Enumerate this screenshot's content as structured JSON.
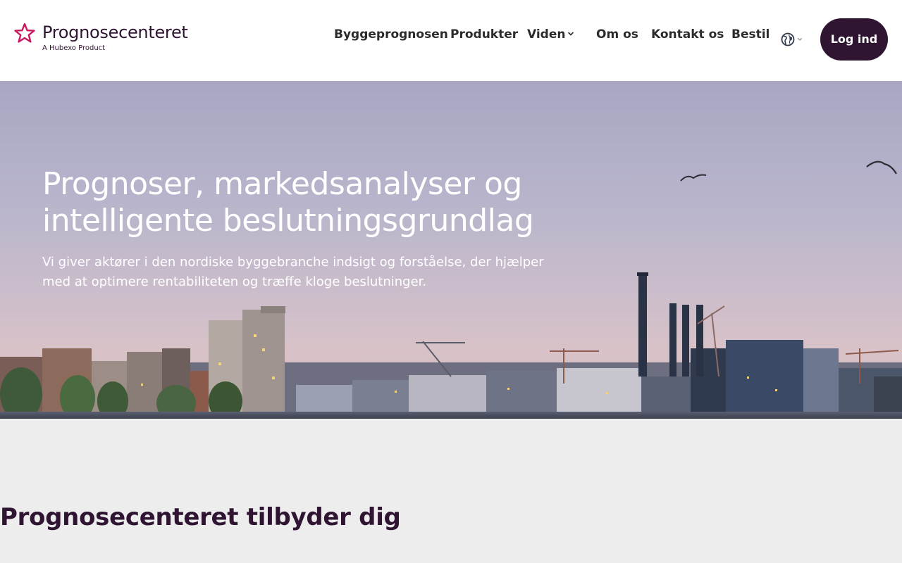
{
  "header": {
    "logo": {
      "name": "Prognosecenteret",
      "tagline": "A Hubexo Product",
      "star_color": "#c8175d",
      "text_color": "#2f1532"
    },
    "nav": [
      {
        "label": "Byggeprognosen"
      },
      {
        "label": "Produkter"
      },
      {
        "label": "Viden",
        "has_dropdown": true
      },
      {
        "label": "Om os"
      },
      {
        "label": "Kontakt os"
      },
      {
        "label": "Bestil"
      }
    ],
    "language_icon": "globe-icon",
    "login_label": "Log ind",
    "login_color": "#2f1532"
  },
  "hero": {
    "title": "Prognoser, markedsanalyser og intelligente beslutningsgrundlag",
    "text": "Vi giver aktører i den nordiske byggebranche indsigt og forståelse, der hjælper med at optimere rentabiliteten og træffe kloge beslutninger."
  },
  "section": {
    "title": "Prognosecenteret tilbyder dig"
  }
}
